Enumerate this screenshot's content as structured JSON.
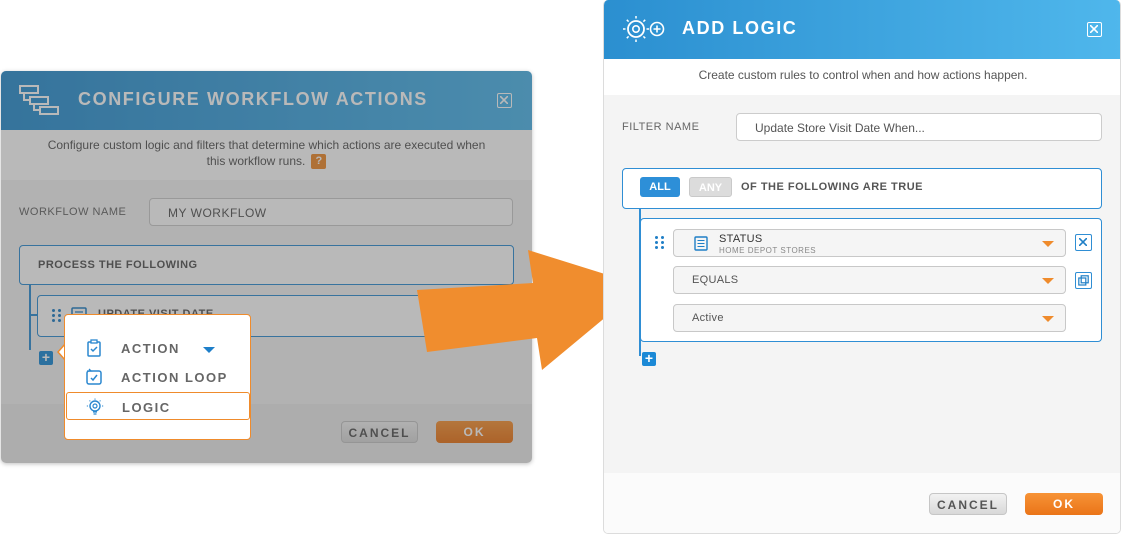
{
  "configure_dialog": {
    "title": "CONFIGURE WORKFLOW ACTIONS",
    "description_line1": "Configure custom logic and filters that determine which actions are executed when",
    "description_line2": "this workflow runs.",
    "help_label": "?",
    "workflow_name_label": "WORKFLOW NAME",
    "workflow_name_value": "MY WORKFLOW",
    "process_label": "PROCESS THE FOLLOWING",
    "action_item_label": "UPDATE VISIT DATE",
    "cancel_label": "CANCEL",
    "ok_label": "OK"
  },
  "add_menu": {
    "items": [
      {
        "label": "ACTION",
        "icon": "clipboard-check-icon"
      },
      {
        "label": "ACTION LOOP",
        "icon": "loop-check-icon"
      },
      {
        "label": "LOGIC",
        "icon": "lightbulb-gear-icon",
        "selected": true
      }
    ]
  },
  "logic_dialog": {
    "title": "ADD LOGIC",
    "description": "Create custom rules to control when and how actions happen.",
    "filter_name_label": "FILTER NAME",
    "filter_name_value": "Update Store Visit Date When...",
    "all_label": "ALL",
    "any_label": "ANY",
    "condition_text": "OF THE FOLLOWING ARE TRUE",
    "field": {
      "name": "STATUS",
      "source": "HOME DEPOT STORES"
    },
    "operator": "EQUALS",
    "value": "Active",
    "cancel_label": "CANCEL",
    "ok_label": "OK"
  },
  "colors": {
    "header_blue": "#2b8fd0",
    "accent_orange": "#ef8b2c",
    "outline_blue": "#2f8ed4"
  }
}
